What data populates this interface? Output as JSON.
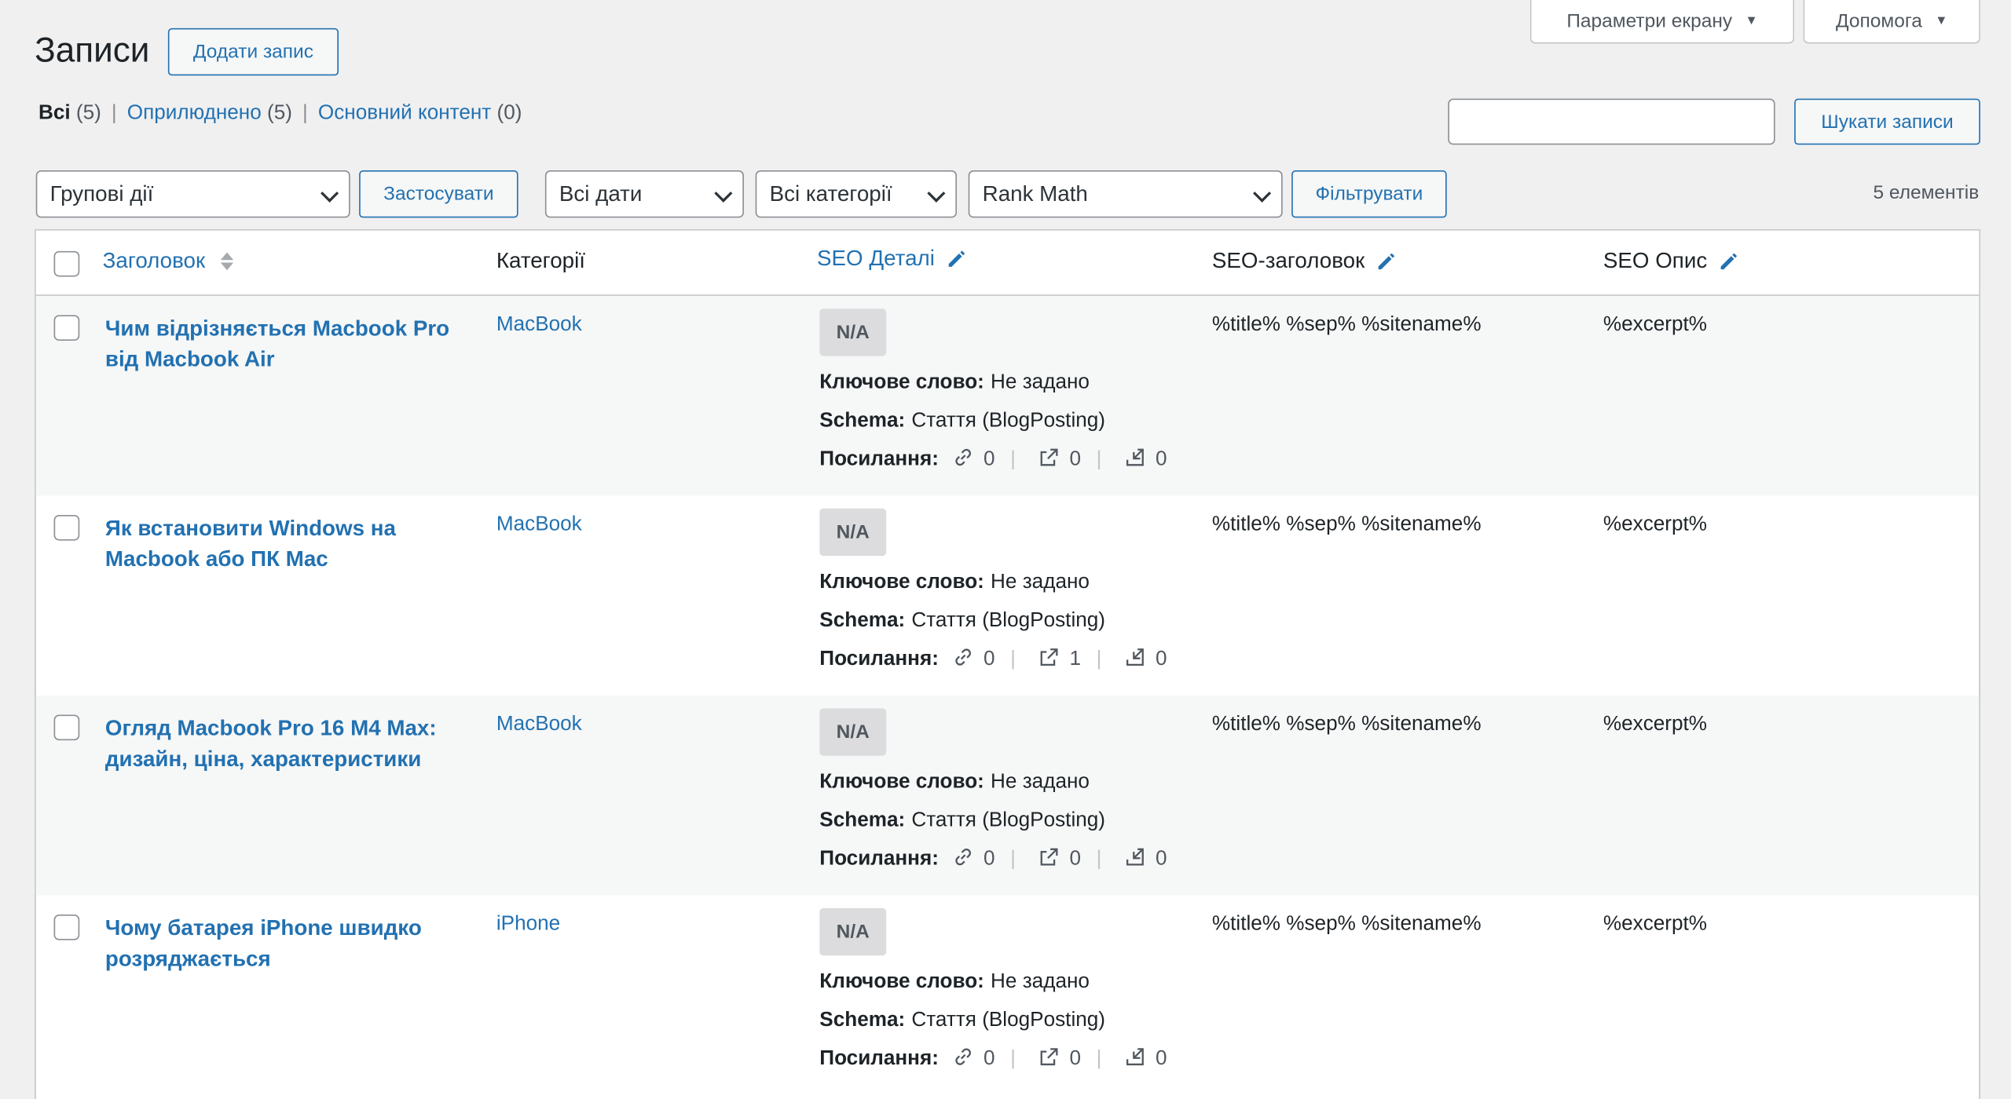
{
  "screen_meta": {
    "screen_options": "Параметри екрану",
    "help": "Допомога"
  },
  "header": {
    "title": "Записи",
    "add_new": "Додати запис"
  },
  "views": {
    "all_label": "Всі",
    "all_count": "(5)",
    "published_label": "Оприлюднено",
    "published_count": "(5)",
    "cornerstone_label": "Основний контент",
    "cornerstone_count": "(0)",
    "separator": "|"
  },
  "search": {
    "value": "",
    "button": "Шукати записи"
  },
  "filters": {
    "bulk_actions": "Групові дії",
    "apply": "Застосувати",
    "dates": "Всі дати",
    "categories": "Всі категорії",
    "seo": "Rank Math",
    "filter_button": "Фільтрувати",
    "items_count": "5 елементів"
  },
  "columns": {
    "title": "Заголовок",
    "categories": "Категорії",
    "seo_details": "SEO Деталі",
    "seo_title": "SEO-заголовок",
    "seo_desc": "SEO Опис"
  },
  "labels": {
    "na": "N/A",
    "keyword": "Ключове слово:",
    "schema": "Schema:",
    "links": "Посилання:"
  },
  "rows": [
    {
      "title": "Чим відрізняється Macbook Pro від Macbook Air",
      "category": "MacBook",
      "keyword_value": "Не задано",
      "schema_value": "Стаття (BlogPosting)",
      "internal": "0",
      "external": "0",
      "incoming": "0",
      "seo_title": "%title% %sep% %sitename%",
      "seo_desc": "%excerpt%"
    },
    {
      "title": "Як встановити Windows на Macbook або ПК Mac",
      "category": "MacBook",
      "keyword_value": "Не задано",
      "schema_value": "Стаття (BlogPosting)",
      "internal": "0",
      "external": "1",
      "incoming": "0",
      "seo_title": "%title% %sep% %sitename%",
      "seo_desc": "%excerpt%"
    },
    {
      "title": "Огляд Macbook Pro 16 M4 Max: дизайн, ціна, характеристики",
      "category": "MacBook",
      "keyword_value": "Не задано",
      "schema_value": "Стаття (BlogPosting)",
      "internal": "0",
      "external": "0",
      "incoming": "0",
      "seo_title": "%title% %sep% %sitename%",
      "seo_desc": "%excerpt%"
    },
    {
      "title": "Чому батарея iPhone швидко розряджається",
      "category": "iPhone",
      "keyword_value": "Не задано",
      "schema_value": "Стаття (BlogPosting)",
      "internal": "0",
      "external": "0",
      "incoming": "0",
      "seo_title": "%title% %sep% %sitename%",
      "seo_desc": "%excerpt%"
    }
  ],
  "colors": {
    "link": "#2271b1",
    "background": "#f0f0f1",
    "row_alt": "#f6f7f7"
  },
  "icons": [
    "dropdown-arrow-icon",
    "sort-icon",
    "pencil-icon",
    "link-icon",
    "external-link-icon",
    "incoming-link-icon",
    "chevron-down-icon"
  ]
}
